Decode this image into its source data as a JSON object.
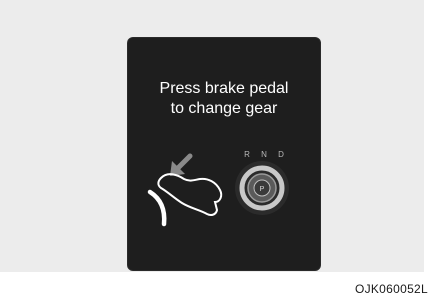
{
  "display": {
    "message_line1": "Press brake pedal",
    "message_line2": "to change gear",
    "gear_positions": [
      "R",
      "N",
      "D"
    ],
    "selected_gear": "P",
    "background_color": "#1e1e1e",
    "text_color": "#ffffff"
  },
  "icons": [
    "down-left-arrow-icon",
    "brake-pedal-icon",
    "foot-icon",
    "gear-dial-icon"
  ],
  "figure_code": "OJK060052L"
}
